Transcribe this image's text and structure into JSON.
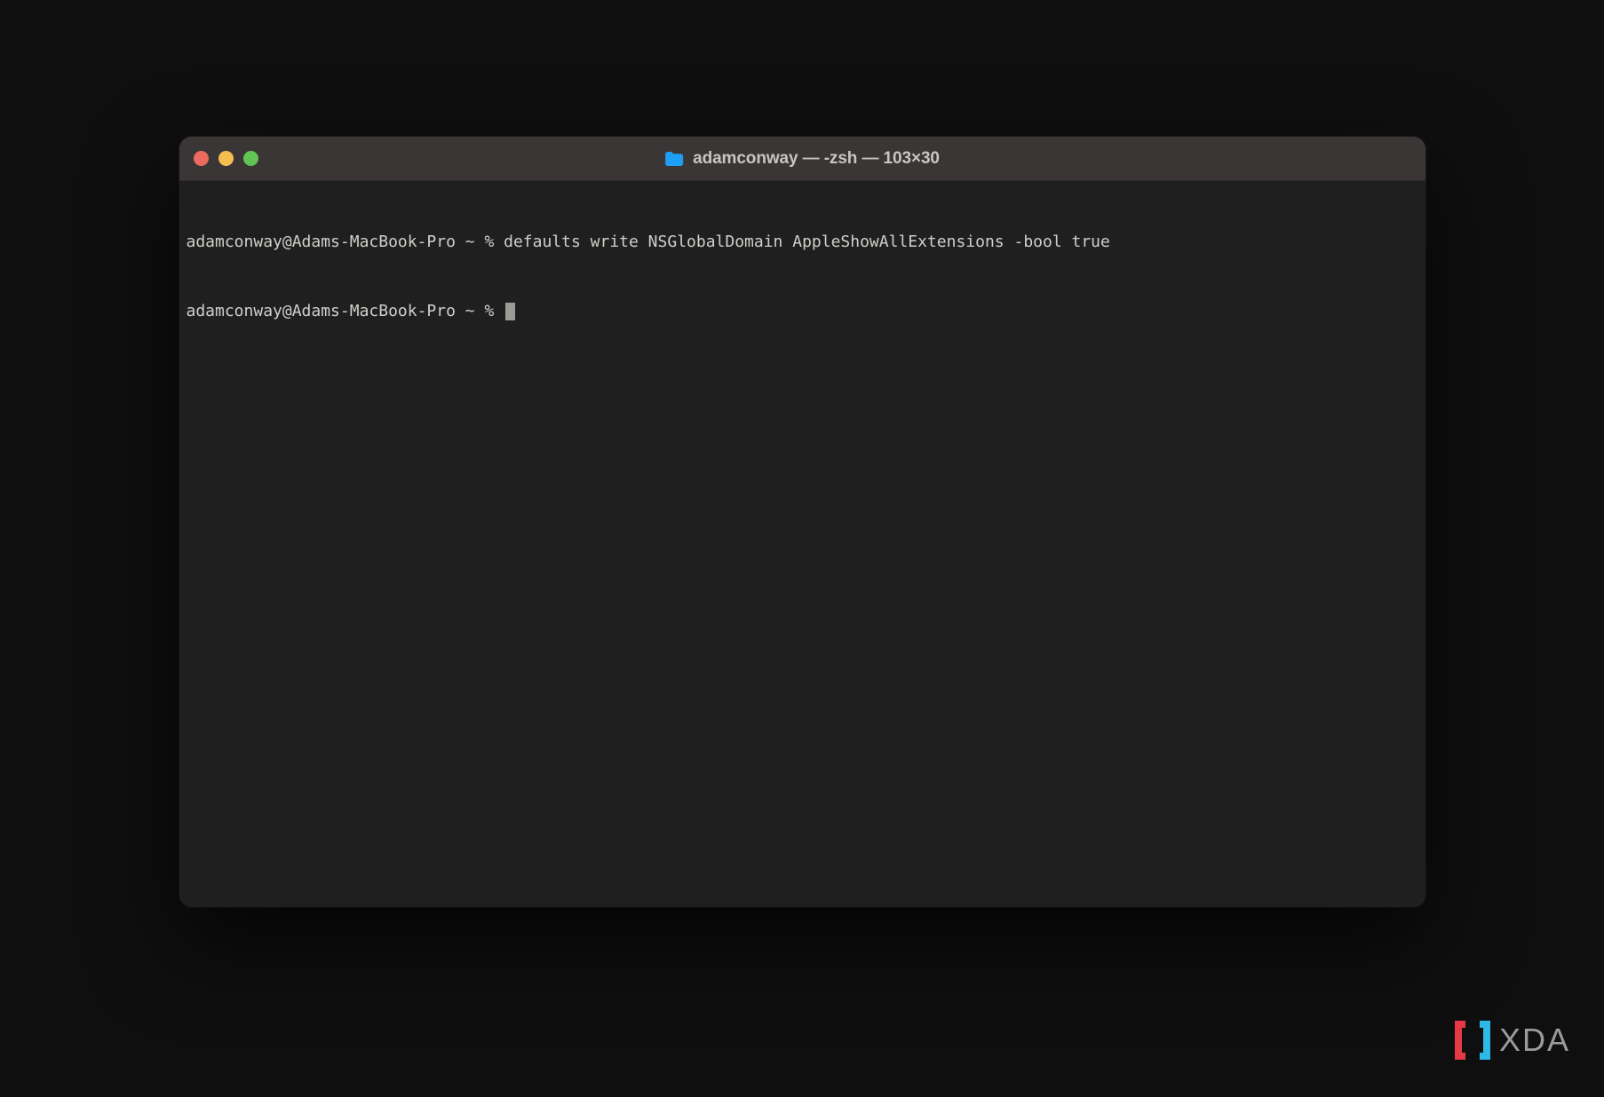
{
  "window": {
    "title": "adamconway — -zsh — 103×30",
    "traffic_lights": {
      "close": "close",
      "minimize": "minimize",
      "maximize": "maximize"
    },
    "folder_icon": "folder-icon"
  },
  "terminal": {
    "lines": [
      {
        "prompt": "adamconway@Adams-MacBook-Pro ~ % ",
        "command": "defaults write NSGlobalDomain AppleShowAllExtensions -bool true"
      },
      {
        "prompt": "adamconway@Adams-MacBook-Pro ~ % ",
        "command": ""
      }
    ]
  },
  "watermark": {
    "text": "XDA"
  }
}
